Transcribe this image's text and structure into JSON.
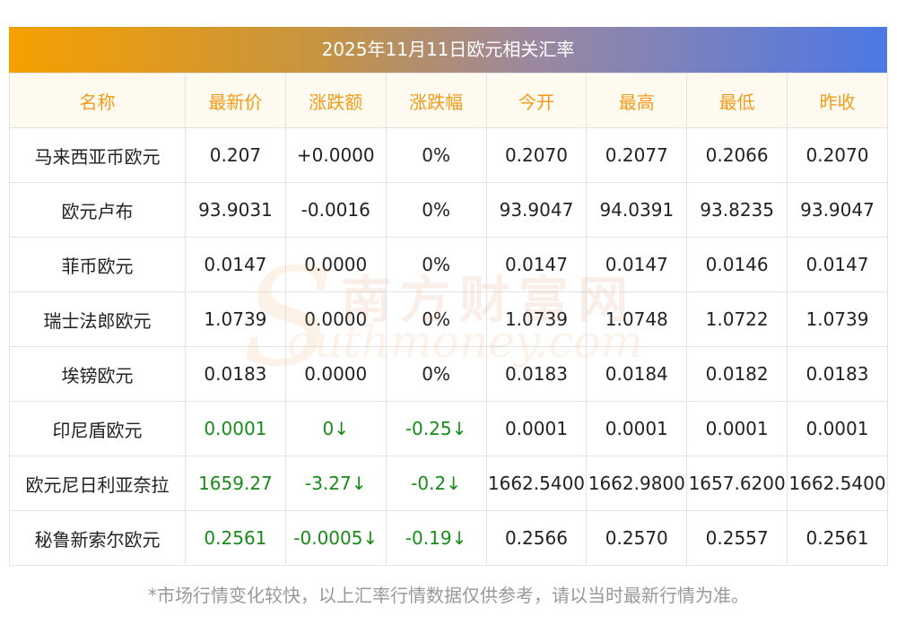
{
  "title": "2025年11月11日欧元相关汇率",
  "columns": [
    "名称",
    "最新价",
    "涨跌额",
    "涨跌幅",
    "今开",
    "最高",
    "最低",
    "昨收"
  ],
  "rows": [
    {
      "name": "马来西亚币欧元",
      "latest": "0.207",
      "change": "+0.0000",
      "change_pct": "0%",
      "open": "0.2070",
      "high": "0.2077",
      "low": "0.2066",
      "prev_close": "0.2070",
      "down": false
    },
    {
      "name": "欧元卢布",
      "latest": "93.9031",
      "change": "-0.0016",
      "change_pct": "0%",
      "open": "93.9047",
      "high": "94.0391",
      "low": "93.8235",
      "prev_close": "93.9047",
      "down": false
    },
    {
      "name": "菲币欧元",
      "latest": "0.0147",
      "change": "0.0000",
      "change_pct": "0%",
      "open": "0.0147",
      "high": "0.0147",
      "low": "0.0146",
      "prev_close": "0.0147",
      "down": false
    },
    {
      "name": "瑞士法郎欧元",
      "latest": "1.0739",
      "change": "0.0000",
      "change_pct": "0%",
      "open": "1.0739",
      "high": "1.0748",
      "low": "1.0722",
      "prev_close": "1.0739",
      "down": false
    },
    {
      "name": "埃镑欧元",
      "latest": "0.0183",
      "change": "0.0000",
      "change_pct": "0%",
      "open": "0.0183",
      "high": "0.0184",
      "low": "0.0182",
      "prev_close": "0.0183",
      "down": false
    },
    {
      "name": "印尼盾欧元",
      "latest": "0.0001",
      "change": "0↓",
      "change_pct": "-0.25↓",
      "open": "0.0001",
      "high": "0.0001",
      "low": "0.0001",
      "prev_close": "0.0001",
      "down": true
    },
    {
      "name": "欧元尼日利亚奈拉",
      "latest": "1659.27",
      "change": "-3.27↓",
      "change_pct": "-0.2↓",
      "open": "1662.5400",
      "high": "1662.9800",
      "low": "1657.6200",
      "prev_close": "1662.5400",
      "down": true
    },
    {
      "name": "秘鲁新索尔欧元",
      "latest": "0.2561",
      "change": "-0.0005↓",
      "change_pct": "-0.19↓",
      "open": "0.2566",
      "high": "0.2570",
      "low": "0.2557",
      "prev_close": "0.2561",
      "down": true
    }
  ],
  "watermark": {
    "cn": "南方财富网",
    "en": "outhmoney.com",
    "initial": "S"
  },
  "footnote": "*市场行情变化较快，以上汇率行情数据仅供参考，请以当时最新行情为准。",
  "colors": {
    "header_text": "#f29b1a",
    "down": "#1a8a1a",
    "grid": "#e3e3e3"
  }
}
